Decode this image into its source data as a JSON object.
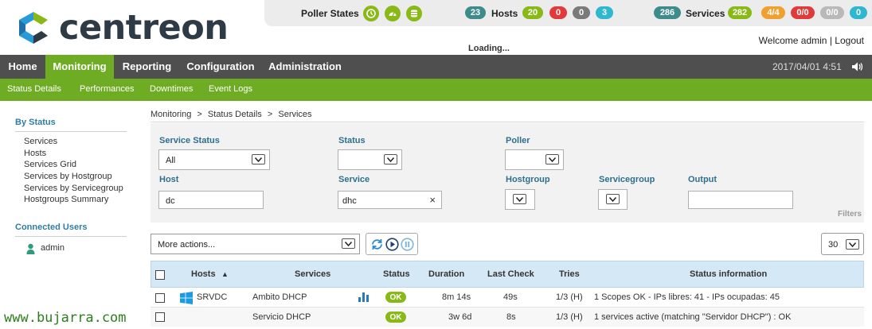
{
  "brand": {
    "name": "centreon"
  },
  "statusbar": {
    "poller_label": "Poller States",
    "hosts_label": "Hosts",
    "hosts_total": "23",
    "hosts_up": "20",
    "hosts_down": "0",
    "hosts_unreachable": "0",
    "hosts_pending": "3",
    "services_label": "Services",
    "services_total": "286",
    "services_ok": "282",
    "services_warning": "4/4",
    "services_critical": "0/0",
    "services_unknown": "0/0",
    "services_pending": "0",
    "colors": {
      "total": "#3d8b8b",
      "ok": "#88b917",
      "warning": "#f0a030",
      "critical": "#e03a3a",
      "unknown": "#b9b9b9",
      "pending": "#2eb8d0"
    }
  },
  "welcome": {
    "text": "Welcome admin",
    "separator": "|",
    "logout": "Logout"
  },
  "loading": "Loading...",
  "nav": {
    "items": [
      "Home",
      "Monitoring",
      "Reporting",
      "Configuration",
      "Administration"
    ],
    "active": "Monitoring",
    "datetime": "2017/04/01 4:51",
    "sound_icon": "speaker-icon"
  },
  "subnav": {
    "items": [
      "Status Details",
      "Performances",
      "Downtimes",
      "Event Logs"
    ]
  },
  "sidebar": {
    "by_status_title": "By Status",
    "by_status_items": [
      "Services",
      "Hosts",
      "Services Grid",
      "Services by Hostgroup",
      "Services by Servicegroup",
      "Hostgroups Summary"
    ],
    "connected_title": "Connected Users",
    "users": [
      "admin"
    ]
  },
  "breadcrumb": [
    "Monitoring",
    ">",
    "Status Details",
    ">",
    "Services"
  ],
  "filters": {
    "service_status_label": "Service Status",
    "service_status_value": "All",
    "status_label": "Status",
    "status_value": "",
    "poller_label": "Poller",
    "poller_value": "",
    "host_label": "Host",
    "host_value": "dc",
    "service_label": "Service",
    "service_value": "dhc",
    "clear_symbol": "×",
    "hostgroup_label": "Hostgroup",
    "servicegroup_label": "Servicegroup",
    "output_label": "Output",
    "output_value": "",
    "section_label": "Filters"
  },
  "actions": {
    "more_actions": "More actions...",
    "page_size": "30"
  },
  "table": {
    "headers": {
      "hosts": "Hosts",
      "sort": "▲",
      "services": "Services",
      "status": "Status",
      "duration": "Duration",
      "last_check": "Last Check",
      "tries": "Tries",
      "status_info": "Status information"
    },
    "rows": [
      {
        "host": "SRVDC",
        "service": "Ambito DHCP",
        "status": "OK",
        "duration": "8m 14s",
        "last_check": "49s",
        "tries": "1/3 (H)",
        "info": "1 Scopes OK - IPs libres: 41 - IPs ocupadas: 45",
        "has_graph": true
      },
      {
        "host": "",
        "service": "Servicio DHCP",
        "status": "OK",
        "duration": "3w 6d",
        "last_check": "8s",
        "tries": "1/3 (H)",
        "info": "1 services active (matching \"Servidor DHCP\") : OK",
        "has_graph": false
      }
    ]
  },
  "watermark": "www.bujarra.com"
}
